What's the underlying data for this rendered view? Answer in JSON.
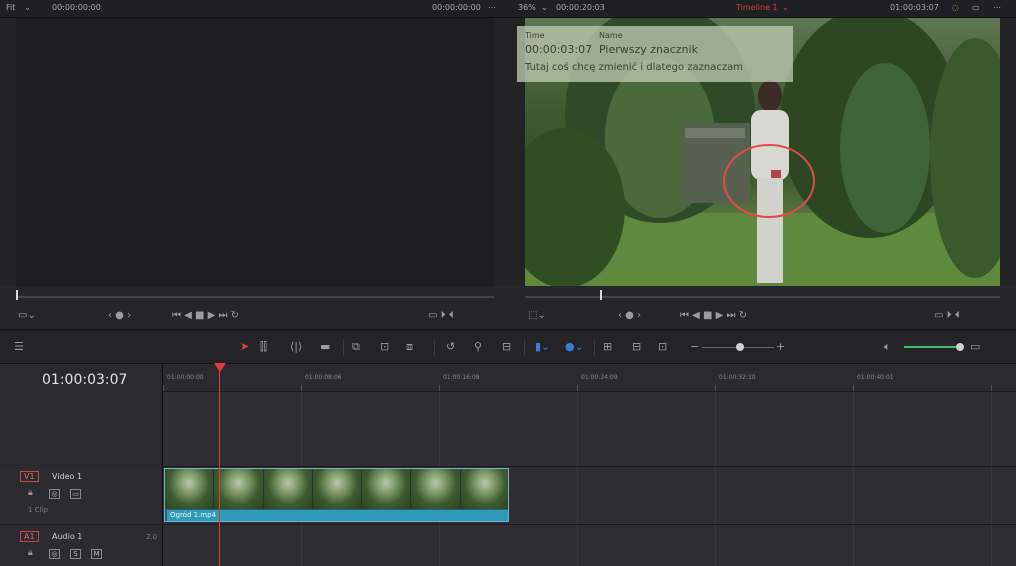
{
  "topbar": {
    "source_label": "Fit",
    "source_timecode": "00:00:00:00",
    "source_timecode_right": "00:00:00:00",
    "timeline_zoom": "36%",
    "timeline_duration": "00:00:20:03",
    "timeline_name": "Timeline 1",
    "timeline_timecode": "01:00:03:07"
  },
  "marker": {
    "time_header": "Time",
    "name_header": "Name",
    "time": "00:00:03:07",
    "name": "Pierwszy znacznik",
    "note": "Tutaj coś chcę zmienić i dlatego zaznaczam"
  },
  "timeline": {
    "timecode": "01:00:03:07",
    "ruler_ticks": [
      "01:00:00:00",
      "01:00:08:06",
      "01:00:16:08",
      "01:00:24:09",
      "01:00:32:10",
      "01:00:40:01"
    ]
  },
  "tracks": {
    "video": {
      "tag": "V1",
      "name": "Video 1",
      "clip_count": "1 Clip"
    },
    "audio": {
      "tag": "A1",
      "name": "Audio 1",
      "level": "2.0"
    }
  },
  "clip": {
    "name": "Ogród 1.mp4"
  },
  "colors": {
    "playhead": "#e03b38",
    "clip_label": "#2f9ab9",
    "timeline_name": "#d0413e"
  }
}
